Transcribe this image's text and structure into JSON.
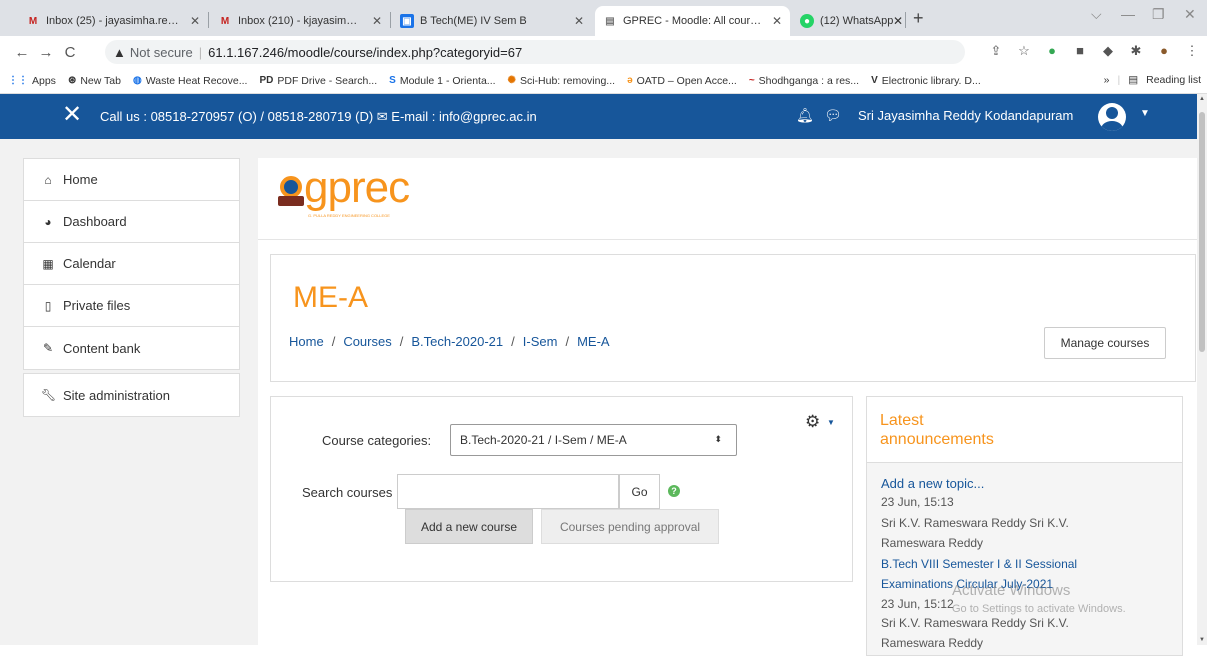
{
  "browser": {
    "tabs": [
      {
        "title": "Inbox (25) - jayasimha.reddy",
        "icon": "gmail-icon"
      },
      {
        "title": "Inbox (210) - kjayasimhareddy",
        "icon": "gmail-icon"
      },
      {
        "title": "B Tech(ME) IV Sem B",
        "icon": "classroom-icon"
      },
      {
        "title": "GPREC - Moodle: All courses",
        "icon": "moodle-icon"
      },
      {
        "title": "(12) WhatsApp",
        "icon": "whatsapp-icon"
      }
    ],
    "not_secure": "Not secure",
    "url": "61.1.167.246/moodle/course/index.php?categoryid=67",
    "bookmarks": [
      {
        "label": "Apps"
      },
      {
        "label": "New Tab"
      },
      {
        "label": "Waste Heat Recove..."
      },
      {
        "label": "PDF Drive - Search..."
      },
      {
        "label": "Module 1 - Orienta..."
      },
      {
        "label": "Sci-Hub: removing..."
      },
      {
        "label": "OATD – Open Acce..."
      },
      {
        "label": "Shodhganga : a res..."
      },
      {
        "label": "Electronic library. D..."
      }
    ],
    "more_bookmarks": "»",
    "reading_list": "Reading list"
  },
  "navbar": {
    "contact": "Call us : 08518-270957 (O) / 08518-280719 (D) ✉ E-mail : info@gprec.ac.in",
    "username": "Sri Jayasimha Reddy Kodandapuram",
    "brand_color": "#17569a"
  },
  "sidebar": {
    "items": [
      {
        "label": "Home",
        "icon": "home-icon"
      },
      {
        "label": "Dashboard",
        "icon": "dashboard-icon"
      },
      {
        "label": "Calendar",
        "icon": "calendar-icon"
      },
      {
        "label": "Private files",
        "icon": "file-icon"
      },
      {
        "label": "Content bank",
        "icon": "brush-icon"
      }
    ],
    "admin": {
      "label": "Site administration",
      "icon": "wrench-icon"
    }
  },
  "logo": {
    "text": "gprec",
    "tagline": "G. PULLA REDDY ENGINEERING COLLEGE"
  },
  "page": {
    "title": "ME-A",
    "breadcrumb": [
      "Home",
      "Courses",
      "B.Tech-2020-21",
      "I-Sem",
      "ME-A"
    ],
    "manage_courses": "Manage courses"
  },
  "category": {
    "label": "Course categories:",
    "selected": "B.Tech-2020-21 / I-Sem / ME-A",
    "search_label": "Search courses",
    "search_value": "",
    "go": "Go",
    "add_course": "Add a new course",
    "pending": "Courses pending approval"
  },
  "announcements": {
    "title": "Latest announcements",
    "add_topic": "Add a new topic...",
    "items": [
      {
        "date": "23 Jun, 15:13",
        "author_1": "Sri K.V. Rameswara Reddy Sri K.V.",
        "author_2": "Rameswara Reddy"
      },
      {
        "subject_1": "B.Tech VIII Semester I & II Sessional",
        "subject_2": "Examinations Circular July-2021",
        "date": "23 Jun, 15:12",
        "author_1": "Sri K.V. Rameswara Reddy Sri K.V.",
        "author_2": "Rameswara Reddy"
      }
    ]
  },
  "watermark": {
    "line1": "Activate Windows",
    "line2": "Go to Settings to activate Windows."
  }
}
